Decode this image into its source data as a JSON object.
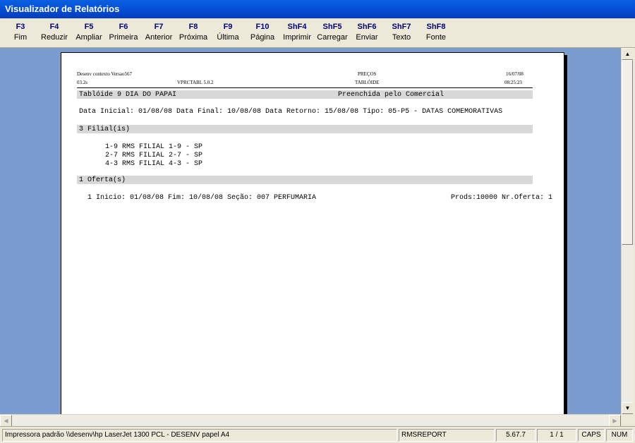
{
  "window": {
    "title": "Visualizador de Relatórios"
  },
  "toolbar": [
    {
      "key": "F3",
      "label": "Fim"
    },
    {
      "key": "F4",
      "label": "Reduzir"
    },
    {
      "key": "F5",
      "label": "Ampliar"
    },
    {
      "key": "F6",
      "label": "Primeira"
    },
    {
      "key": "F7",
      "label": "Anterior"
    },
    {
      "key": "F8",
      "label": "Próxima"
    },
    {
      "key": "F9",
      "label": "Última"
    },
    {
      "key": "F10",
      "label": "Página"
    },
    {
      "key": "ShF4",
      "label": "Imprimir"
    },
    {
      "key": "ShF5",
      "label": "Carregar"
    },
    {
      "key": "ShF6",
      "label": "Enviar"
    },
    {
      "key": "ShF7",
      "label": "Texto"
    },
    {
      "key": "ShF8",
      "label": "Fonte"
    }
  ],
  "report": {
    "header": {
      "company": "Desenv contexto Versao567",
      "code": "03.2s",
      "program": "VPRCTABL 5.0.2",
      "title": "PREÇOS",
      "subtitle": "TABLÓIDE",
      "date": "16/07/08",
      "time": "08:25:23"
    },
    "tabloide_line": "Tablóide  9  DIA DO PAPAI",
    "status": "Preenchida pelo Comercial",
    "dates_line": "Data Inicial: 01/08/08  Data Final: 10/08/08  Data Retorno: 15/08/08  Tipo: 05-P5 - DATAS COMEMORATIVAS",
    "filiais_header": "3  Filial(is)",
    "filiais": [
      "1-9  RMS FILIAL 1-9 - SP",
      "2-7  RMS FILIAL 2-7 - SP",
      "4-3  RMS FILIAL 4-3 - SP"
    ],
    "ofertas_header": "1  Oferta(s)",
    "oferta_line": "1  Inicio: 01/08/08   Fim: 10/08/08   Seção: 007 PERFUMARIA",
    "oferta_prods": "Prods:10000   Nr.Oferta: 1"
  },
  "statusbar": {
    "printer": "Impressora padrão \\\\desenv\\hp LaserJet 1300 PCL - DESENV papel A4",
    "report_name": "RMSREPORT",
    "version": "5.67.7",
    "page": "1 / 1",
    "caps": "CAPS",
    "num": "NUM"
  }
}
